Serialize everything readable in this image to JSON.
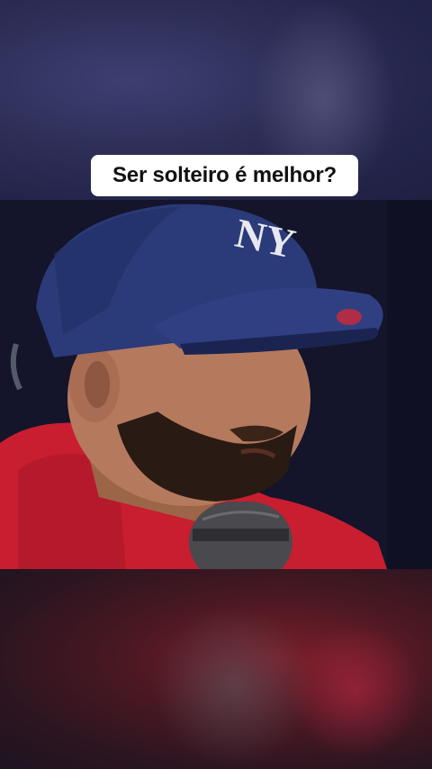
{
  "caption": {
    "text": "Ser solteiro é melhor?"
  },
  "video": {
    "cap_logo_text": "NY",
    "colors": {
      "cap": "#2b3a78",
      "shirt": "#c81e30",
      "skin": "#b57a5e",
      "beard": "#2a1a14",
      "mic": "#4a4a4e"
    }
  }
}
